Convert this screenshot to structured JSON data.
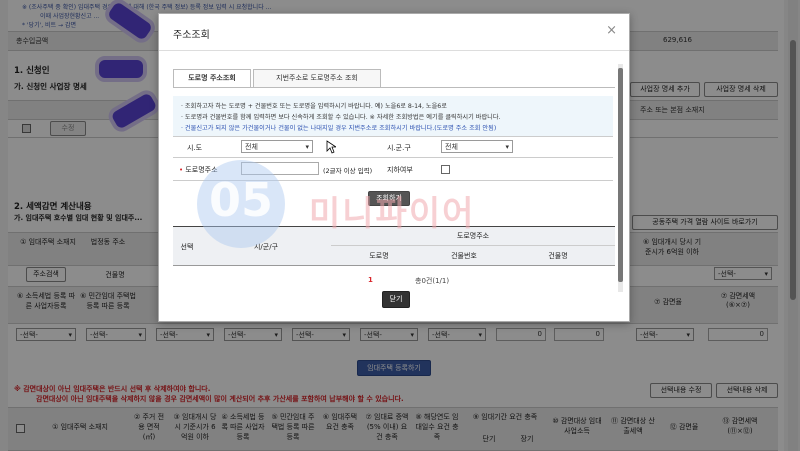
{
  "background": {
    "top_notice_1": "※ (조사주택 중 확인) 임대주택 경우 주택에 대해 (한국 주택 정보) 등록 정보 입력 시 요청합니다 ...",
    "top_notice_2": "이때 사업장현황신고 ...",
    "top_notice_3": "* '당기', 비트 → 감면",
    "total_label": "총수입금액",
    "total_value": "629,616",
    "section1_title": "1. 신청인",
    "section1_sub": "가. 신청인 사업장 명세",
    "btn_add_business": "사업장 명세 추가",
    "btn_delete_business": "사업장 명세 삭제",
    "col_address": "주소 또는 본점 소재지",
    "btn_modify": "수정",
    "section2_title": "2. 세액감면 계산내용",
    "section2_sub": "가. 임대주택 호수별 임대 현황 및 임대주...",
    "btn_price_site": "공동주택 가격 열람 사이트 바로가기",
    "col1": "① 임대주택 소재지",
    "col2": "법정동 주소",
    "btn_address_search": "주소검색",
    "col_building": "건물명",
    "col_rent_time": "⑥ 임대개시 당시 기준시가 6억원 이하",
    "col_tax_reg": "⑥ 소득세법 등록 따른 사업자등록",
    "col_private_reg": "⑥ 민간임대 주택법 등록 따른 등록",
    "col_reduce_rate": "⑦ 감면율",
    "col_reduce_amount": "⑦ 감면세액 (⑥×⑦)",
    "select_placeholder": "-선택-",
    "zero": "0",
    "btn_register_house": "임대주택 등록하기",
    "warning_1": "※ 감면대상이 아닌 임대주택은 반드시 선택 후 삭제하여야 합니다.",
    "warning_2": "감면대상이 아닌 임대주택을 삭제하지 않을 경우 감면세액이 많이 계산되어 추후 가산세를 포함하여 납부해야 할 수 있습니다.",
    "btn_modify_selection": "선택내용 수정",
    "btn_delete_selection": "선택내용 삭제",
    "table2_headers": [
      "① 임대주택 소재지",
      "② 주거 전용 면적 (㎡)",
      "③ 임대개시 당시 기준시가 6억원 이하",
      "④ 소득세법 등록 따른 사업자등록",
      "⑤ 민간임대 주택법 등록 따른 등록",
      "⑥ 임대주택 요건 충족",
      "⑦ 임대료 증액 (5% 이내) 요건 충족",
      "⑧ 해당연도 임대일수 요건 충족",
      "⑨ 임대기간 요건 충족",
      "⑩ 감면대상 임대사업소득",
      "⑪ 감면대상 산출세액",
      "⑫ 감면율",
      "⑬ 감면세액 (⑪×⑫)"
    ],
    "term_short": "단기",
    "term_long": "장기"
  },
  "modal": {
    "title": "주소조회",
    "close": "×",
    "tab_road": "도로명 주소조회",
    "tab_lot": "지번주소로 도로명주소 조회",
    "notice": [
      "· 조회하고자 하는 도로명 + 건물번호 또는 도로명을 입력하시기 바랍니다. 예) 노을6로 8-14, 노을6로",
      "· 도로명과 건물번호를 함께 입력하면 보다 신속하게 조회할 수 있습니다. ※ 자세한 조회방법은 예기를 클릭하시기 바랍니다.",
      "· 건물신고가 되지 않은 가건물이거나 건물이 없는 나대지일 경우 지번주소로 조회하시기 바랍니다.(도로명 주소 조회 안됨)"
    ],
    "sido_label": "시.도",
    "sido_value": "전체",
    "sigungu_label": "시.군.구",
    "sigungu_value": "전체",
    "road_label": "도로명주소",
    "road_hint": "(2글자 이상 입력)",
    "underground_label": "지하여부",
    "search_button": "조회하기",
    "col_select": "선택",
    "col_sigungu": "시/군/구",
    "col_road_address": "도로명주소",
    "col_road": "도로명",
    "col_building_no": "건물번호",
    "col_building_name": "건물명",
    "page_number": "1",
    "result_count": "총0건(1/1)",
    "close_button": "닫기"
  },
  "watermark": {
    "number": "05",
    "text": "미니파이어"
  },
  "colors": {
    "annotation_stroke": "#5a44d6",
    "primary_button": "#3d5ea8",
    "warning_red": "#d8262b"
  }
}
